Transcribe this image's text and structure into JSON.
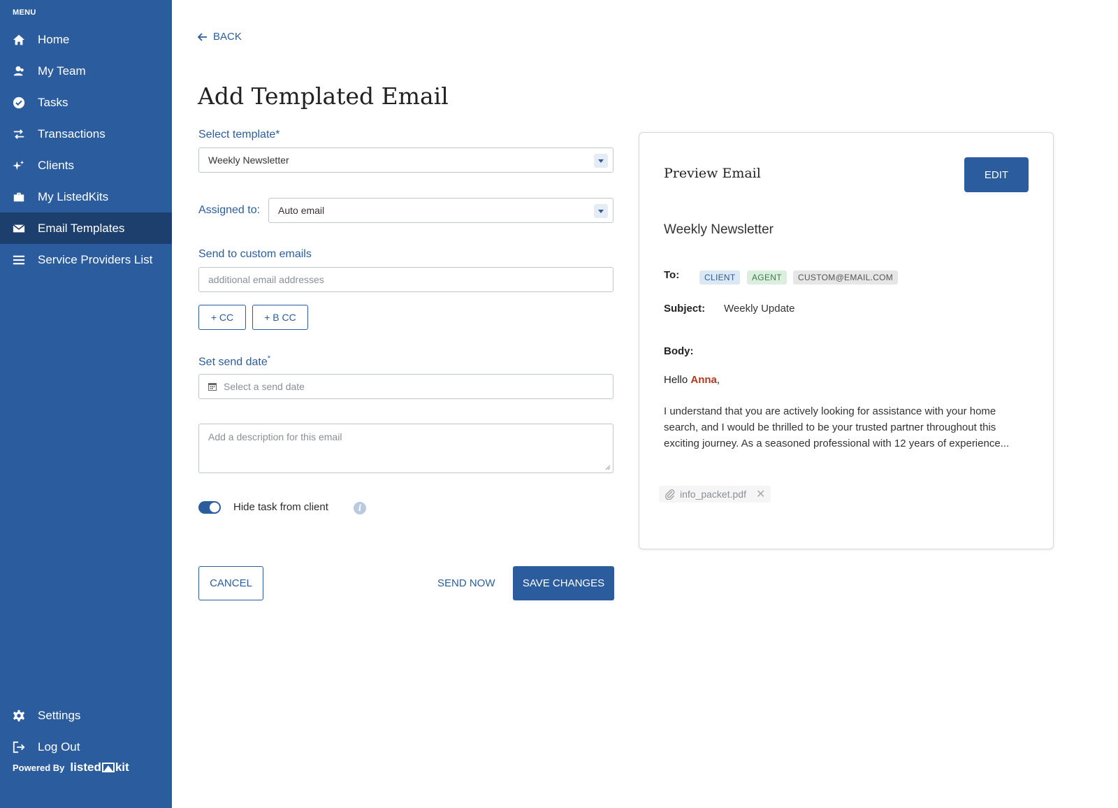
{
  "sidebar": {
    "menu_label": "MENU",
    "items": [
      {
        "label": "Home",
        "icon": "home-icon"
      },
      {
        "label": "My Team",
        "icon": "team-icon"
      },
      {
        "label": "Tasks",
        "icon": "check-circle-icon"
      },
      {
        "label": "Transactions",
        "icon": "swap-arrows-icon"
      },
      {
        "label": "Clients",
        "icon": "sparkle-icon"
      },
      {
        "label": "My ListedKits",
        "icon": "briefcase-icon"
      },
      {
        "label": "Email Templates",
        "icon": "envelope-icon",
        "active": true
      },
      {
        "label": "Service Providers List",
        "icon": "list-icon"
      }
    ],
    "bottom_items": [
      {
        "label": "Settings",
        "icon": "gear-icon"
      },
      {
        "label": "Log Out",
        "icon": "logout-icon"
      }
    ],
    "powered_by": "Powered By",
    "brand_left": "listed",
    "brand_right": "kit"
  },
  "header": {
    "back_label": "BACK",
    "title": "Add Templated Email"
  },
  "form": {
    "template_label": "Select template*",
    "template_value": "Weekly Newsletter",
    "assigned_label": "Assigned to:",
    "assigned_value": "Auto email",
    "custom_emails_label": "Send to custom emails",
    "custom_emails_placeholder": "additional email addresses",
    "cc_label": "+ CC",
    "bcc_label": "+ B CC",
    "send_date_label": "Set send date",
    "send_date_required": "*",
    "send_date_placeholder": "Select a send date",
    "description_placeholder": "Add a description for this email",
    "hide_task_label": "Hide task from client",
    "hide_task_on": true
  },
  "actions": {
    "cancel": "CANCEL",
    "send_now": "SEND NOW",
    "save": "SAVE CHANGES"
  },
  "preview": {
    "title": "Preview Email",
    "edit_label": "EDIT",
    "template_name": "Weekly Newsletter",
    "to_label": "To:",
    "recipients": [
      "CLIENT",
      "AGENT",
      "CUSTOM@EMAIL.COM"
    ],
    "subject_label": "Subject:",
    "subject_value": "Weekly Update",
    "body_label": "Body:",
    "greeting_prefix": "Hello ",
    "greeting_name": "Anna",
    "greeting_suffix": ",",
    "body_text": "I understand that you are actively looking for assistance with your home search, and I would be thrilled to be your trusted partner throughout this exciting journey. As a seasoned professional with 12 years of experience...",
    "attachment": "info_packet.pdf"
  },
  "colors": {
    "sidebar_bg": "#2b5d9e",
    "sidebar_active": "#1c3f6e",
    "primary": "#2b5d9e",
    "highlight_name": "#b03a1d"
  }
}
